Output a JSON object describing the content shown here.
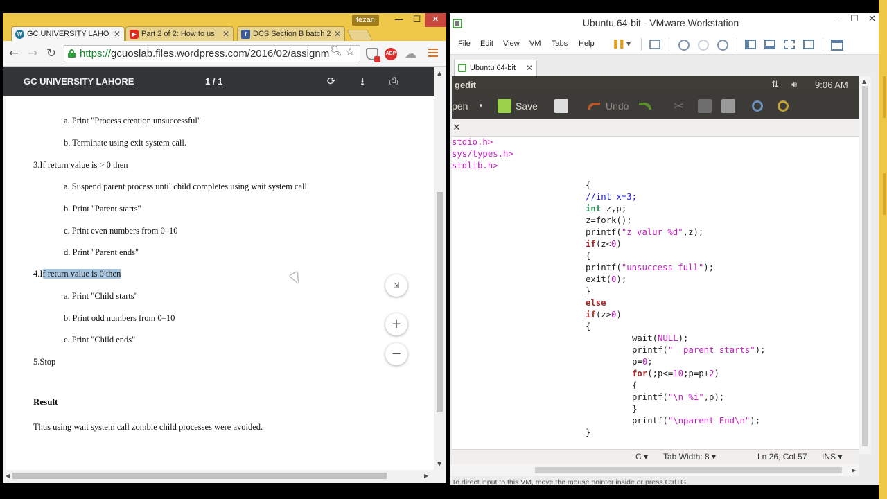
{
  "chrome": {
    "user": "fezan",
    "window_controls": {
      "minimize": "—",
      "maximize": "☐",
      "close": "✕"
    },
    "tabs": [
      {
        "label": "GC UNIVERSITY LAHO",
        "favicon": "wordpress-icon",
        "favicon_color": "#21759b",
        "favicon_glyph": "W",
        "active": true
      },
      {
        "label": "Part 2 of 2: How to us",
        "favicon": "youtube-icon",
        "favicon_color": "#e02a20",
        "favicon_glyph": "▶",
        "active": false
      },
      {
        "label": "DCS Section B batch 2",
        "favicon": "facebook-icon",
        "favicon_color": "#3b5998",
        "favicon_glyph": "f",
        "active": false
      }
    ],
    "tab_close": "✕",
    "nav": {
      "back": "←",
      "forward": "→",
      "reload": "↻"
    },
    "url_scheme": "https://",
    "url_rest": "gcuoslab.files.wordpress.com/2016/02/assignm",
    "omni_search": "🔍︎",
    "omni_star": "☆",
    "ext_abp": "ABP",
    "ext_cloud": "☁"
  },
  "pdf": {
    "title": "GC UNIVERSITY LAHORE",
    "page_indicator": "1 / 1",
    "rotate": "⟳",
    "download": "⭳",
    "print": "⎙",
    "lines": {
      "l1": "a. Print \"Process creation unsuccessful\"",
      "l2": "b. Terminate using exit system call.",
      "l3": "3.If return value is > 0 then",
      "l4": "a. Suspend parent process until child completes using wait system call",
      "l5": "b. Print \"Parent starts\"",
      "l6": "c. Print even numbers from 0–10",
      "l7": "d. Print \"Parent ends\"",
      "l8_prefix": "4.I",
      "l8_highlight": "f return value is 0 then",
      "l9": "a. Print \"Child starts\"",
      "l10": "b. Print odd numbers from 0–10",
      "l11": "c. Print \"Child ends\"",
      "l12": "5.Stop",
      "result_heading": "Result",
      "result_text": "Thus using wait system call zombie child processes were avoided."
    },
    "zoom_fit": "⇲",
    "zoom_in": "+",
    "zoom_out": "−"
  },
  "vmware": {
    "title": "Ubuntu 64-bit - VMware Workstation",
    "window_controls": {
      "minimize": "—",
      "maximize": "☐",
      "close": "✕"
    },
    "menu": {
      "file": "File",
      "edit": "Edit",
      "view": "View",
      "vm": "VM",
      "tabs": "Tabs",
      "help": "Help"
    },
    "toolbar_icons": {
      "pause": "❚❚",
      "pause_dropdown": "▼"
    },
    "tab_label": "Ubuntu 64-bit",
    "tab_close": "✕",
    "status_text": "To direct input to this VM, move the mouse pointer inside or press Ctrl+G."
  },
  "ubuntu": {
    "app_name": "gedit",
    "net_icon": "⇅",
    "sound_icon": "🔊︎",
    "clock": "9:06 AM",
    "toolbar": {
      "open_label": "pen",
      "open_dropdown": "▼",
      "save_label": "Save",
      "undo_label": "Undo",
      "cut_icon": "✂"
    },
    "doc_close": "✕",
    "code": {
      "inc1": "stdio.h>",
      "inc2": "sys/types.h>",
      "inc3": "stdlib.h>"
    },
    "status": {
      "language": "C ▾",
      "tab_width": "Tab Width: 8 ▾",
      "position": "Ln 26, Col 57",
      "mode": "INS ▾"
    }
  }
}
